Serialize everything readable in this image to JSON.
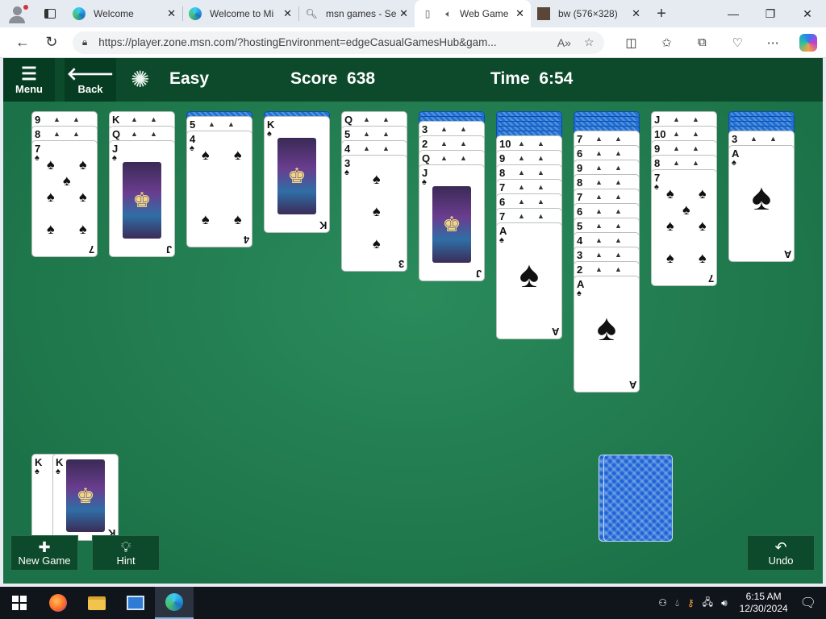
{
  "browser": {
    "tabs": [
      {
        "title": "Welcome",
        "icon": "edge-icon"
      },
      {
        "title": "Welcome to Mi",
        "icon": "edge-icon"
      },
      {
        "title": "msn games - Se",
        "icon": "search-icon"
      },
      {
        "title": "Web Game",
        "icon": "page-icon"
      },
      {
        "title": "bw (576×328)",
        "icon": "image-icon"
      }
    ],
    "url": "https://player.zone.msn.com/?hostingEnvironment=edgeCasualGamesHub&gam..."
  },
  "game": {
    "menu_label": "Menu",
    "back_label": "Back",
    "difficulty": "Easy",
    "score_label": "Score",
    "score": "638",
    "time_label": "Time",
    "time": "6:54",
    "new_game_label": "New Game",
    "hint_label": "Hint",
    "undo_label": "Undo",
    "suit": "♠",
    "face_cards": {
      "queen_glyph": "♛",
      "king_glyph": "♚"
    },
    "columns": [
      {
        "down": 0,
        "up": [
          "9",
          "8",
          "7"
        ]
      },
      {
        "down": 0,
        "up": [
          "K",
          "Q",
          "J"
        ]
      },
      {
        "down": 1,
        "up": [
          "5",
          "4"
        ]
      },
      {
        "down": 1,
        "up": [
          "K"
        ]
      },
      {
        "down": 0,
        "up": [
          "Q",
          "5",
          "4",
          "3"
        ]
      },
      {
        "down": 2,
        "up": [
          "3",
          "2",
          "Q",
          "J"
        ]
      },
      {
        "down": 5,
        "up": [
          "10",
          "9",
          "8",
          "7",
          "6",
          "7",
          "A"
        ]
      },
      {
        "down": 4,
        "up": [
          "7",
          "6",
          "9",
          "8",
          "7",
          "6",
          "5",
          "4",
          "3",
          "2",
          "A"
        ]
      },
      {
        "down": 0,
        "up": [
          "J",
          "10",
          "9",
          "8",
          "7"
        ]
      },
      {
        "down": 4,
        "up": [
          "3",
          "A"
        ]
      }
    ],
    "completed": [
      "K",
      "K"
    ],
    "stock_count": 2
  },
  "taskbar": {
    "time": "6:15 AM",
    "date": "12/30/2024"
  }
}
